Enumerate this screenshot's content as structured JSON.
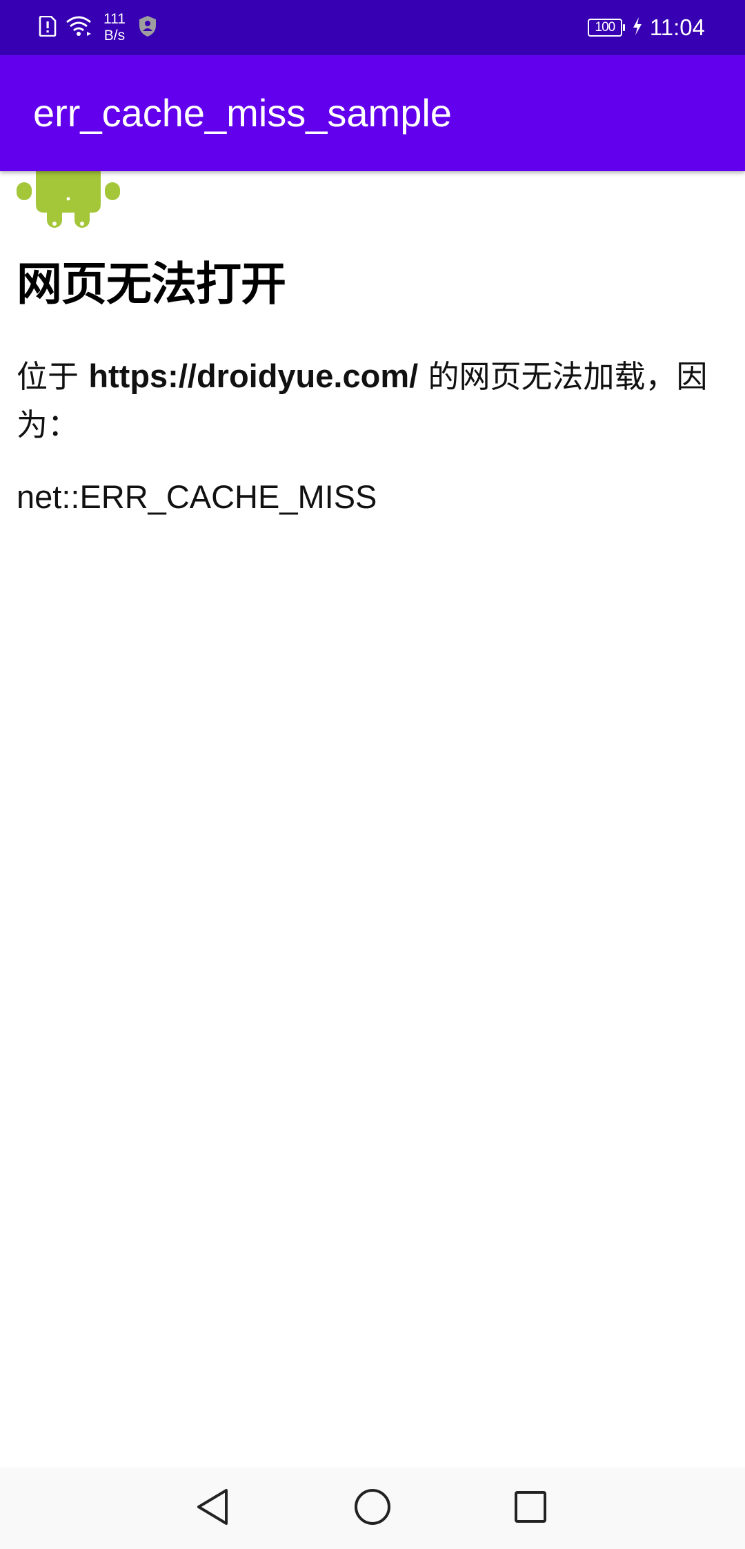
{
  "status_bar": {
    "network_speed_value": "111",
    "network_speed_unit": "B/s",
    "battery_level": "100",
    "time": "11:04",
    "icons": [
      "alert-sim-icon",
      "wifi-icon",
      "shield-icon",
      "battery-icon",
      "charging-icon"
    ]
  },
  "app_bar": {
    "title": "err_cache_miss_sample"
  },
  "webview": {
    "error_title": "网页无法打开",
    "desc_prefix": "位于 ",
    "desc_url": "https://droidyue.com/",
    "desc_suffix": " 的网页无法加载，因为：",
    "error_code": "net::ERR_CACHE_MISS"
  },
  "nav_bar": {
    "icons": [
      "back-icon",
      "home-icon",
      "recents-icon"
    ]
  },
  "colors": {
    "status_bar": "#3700b3",
    "app_bar": "#6200ee",
    "android_robot": "#a4c639",
    "nav_bar": "#f9f9f9"
  }
}
